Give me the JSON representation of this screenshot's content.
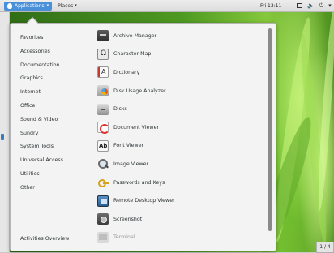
{
  "topbar": {
    "applications_label": "Applications",
    "places_label": "Places",
    "caret": "▾",
    "clock": "Fri 13:11",
    "window_icon": "window-icon",
    "volume_icon": "🔈",
    "power_icon": "⏻",
    "power_caret": "▾"
  },
  "menu": {
    "categories": [
      "Favorites",
      "Accessories",
      "Documentation",
      "Graphics",
      "Internet",
      "Office",
      "Sound & Video",
      "Sundry",
      "System Tools",
      "Universal Access",
      "Utilities",
      "Other"
    ],
    "apps": [
      {
        "label": "Archive Manager",
        "icon": "archive-manager-icon"
      },
      {
        "label": "Character Map",
        "icon": "character-map-icon"
      },
      {
        "label": "Dictionary",
        "icon": "dictionary-icon"
      },
      {
        "label": "Disk Usage Analyzer",
        "icon": "disk-usage-analyzer-icon"
      },
      {
        "label": "Disks",
        "icon": "disks-icon"
      },
      {
        "label": "Document Viewer",
        "icon": "document-viewer-icon"
      },
      {
        "label": "Font Viewer",
        "icon": "font-viewer-icon"
      },
      {
        "label": "Image Viewer",
        "icon": "image-viewer-icon"
      },
      {
        "label": "Passwords and Keys",
        "icon": "passwords-and-keys-icon"
      },
      {
        "label": "Remote Desktop Viewer",
        "icon": "remote-desktop-viewer-icon"
      },
      {
        "label": "Screenshot",
        "icon": "screenshot-icon"
      },
      {
        "label": "Terminal",
        "icon": "terminal-icon"
      }
    ],
    "activities_overview": "Activities Overview"
  },
  "workspace": {
    "indicator": "1 / 4"
  },
  "colors": {
    "accent": "#4a90d9",
    "menu_bg": "#f3f3f3",
    "wallpaper": "#4f9a22"
  }
}
